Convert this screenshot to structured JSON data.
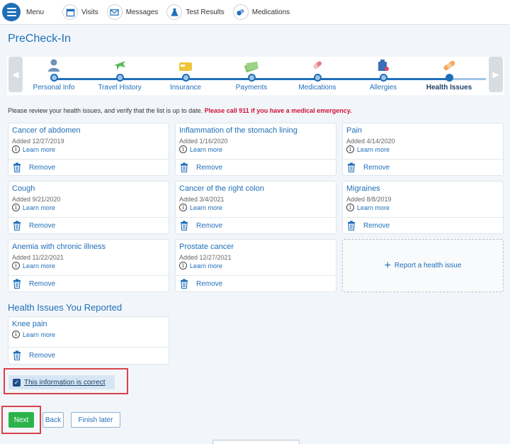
{
  "nav": {
    "menu_label": "Menu",
    "items": [
      {
        "label": "Visits",
        "icon": "calendar-icon"
      },
      {
        "label": "Messages",
        "icon": "envelope-icon"
      },
      {
        "label": "Test Results",
        "icon": "flask-icon"
      },
      {
        "label": "Medications",
        "icon": "pill-icon"
      }
    ]
  },
  "page": {
    "title": "PreCheck-In",
    "instructions": "Please review your health issues, and verify that the list is up to date.",
    "emergency": "Please call 911 if you have a medical emergency."
  },
  "stepper": {
    "steps": [
      {
        "label": "Personal Info",
        "icon": "person-icon"
      },
      {
        "label": "Travel History",
        "icon": "airplane-icon"
      },
      {
        "label": "Insurance",
        "icon": "card-icon"
      },
      {
        "label": "Payments",
        "icon": "money-icon"
      },
      {
        "label": "Medications",
        "icon": "pill-icon"
      },
      {
        "label": "Allergies",
        "icon": "allergy-icon"
      },
      {
        "label": "Health Issues",
        "icon": "bandage-icon",
        "active": true
      }
    ]
  },
  "issues": [
    {
      "title": "Cancer of abdomen",
      "date": "Added 12/27/2019"
    },
    {
      "title": "Inflammation of the stomach lining",
      "date": "Added 1/16/2020"
    },
    {
      "title": "Pain",
      "date": "Added 4/14/2020"
    },
    {
      "title": "Cough",
      "date": "Added 9/21/2020"
    },
    {
      "title": "Cancer of the right colon",
      "date": "Added 3/4/2021"
    },
    {
      "title": "Migraines",
      "date": "Added 8/8/2019"
    },
    {
      "title": "Anemia with chronic illness",
      "date": "Added 11/22/2021"
    },
    {
      "title": "Prostate cancer",
      "date": "Added 12/27/2021"
    }
  ],
  "card_labels": {
    "learn_more": "Learn more",
    "remove": "Remove"
  },
  "report_label": "Report a health issue",
  "reported": {
    "section_title": "Health Issues You Reported",
    "items": [
      {
        "title": "Knee pain"
      }
    ]
  },
  "confirm_label": "This information is correct",
  "buttons": {
    "next": "Next",
    "back": "Back",
    "finish_later": "Finish later"
  },
  "colors": {
    "accent": "#1f6fb8",
    "emergency": "#d0103a",
    "next_button": "#2bb34a",
    "highlight_box": "#d9424a"
  }
}
